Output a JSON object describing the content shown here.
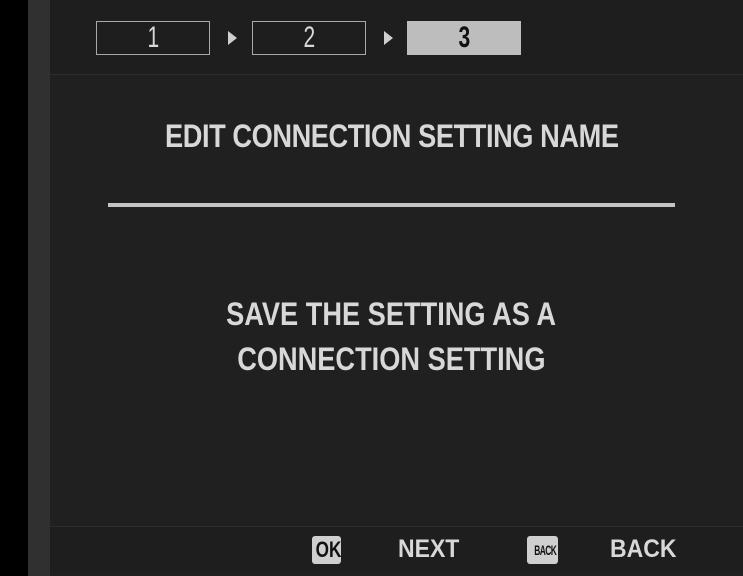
{
  "steps": {
    "items": [
      {
        "label": "1",
        "active": false
      },
      {
        "label": "2",
        "active": false
      },
      {
        "label": "3",
        "active": true
      }
    ],
    "current": 3,
    "total": 3
  },
  "dialog": {
    "title": "EDIT CONNECTION SETTING NAME",
    "message_line1": "SAVE THE SETTING AS A",
    "message_line2": "CONNECTION SETTING"
  },
  "footer": {
    "ok_key": "OK",
    "ok_label": "NEXT",
    "back_key": "BACK",
    "back_label": "BACK"
  },
  "icons": {
    "left_nav": "chevron-left-icon",
    "step_separator": "chevron-right-icon"
  },
  "colors": {
    "background": "#202020",
    "text": "#d8d8d8",
    "active_step": "#bdbdbd",
    "divider": "#c4c4c4"
  }
}
